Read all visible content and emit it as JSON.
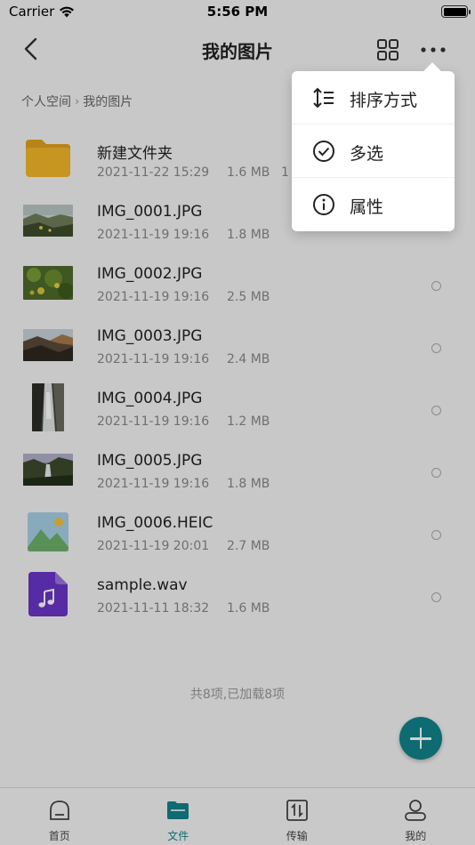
{
  "status_bar": {
    "carrier": "Carrier",
    "time": "5:56 PM"
  },
  "nav": {
    "title": "我的图片"
  },
  "breadcrumb": {
    "root": "个人空间",
    "current": "我的图片"
  },
  "files": [
    {
      "name": "新建文件夹",
      "date": "2021-11-22 15:29",
      "size": "1.6 MB",
      "extra": "1",
      "type": "folder"
    },
    {
      "name": "IMG_0001.JPG",
      "date": "2021-11-19 19:16",
      "size": "1.8 MB",
      "type": "photo"
    },
    {
      "name": "IMG_0002.JPG",
      "date": "2021-11-19 19:16",
      "size": "2.5 MB",
      "type": "photo"
    },
    {
      "name": "IMG_0003.JPG",
      "date": "2021-11-19 19:16",
      "size": "2.4 MB",
      "type": "photo"
    },
    {
      "name": "IMG_0004.JPG",
      "date": "2021-11-19 19:16",
      "size": "1.2 MB",
      "type": "photo"
    },
    {
      "name": "IMG_0005.JPG",
      "date": "2021-11-19 19:16",
      "size": "1.8 MB",
      "type": "photo"
    },
    {
      "name": "IMG_0006.HEIC",
      "date": "2021-11-19 20:01",
      "size": "2.7 MB",
      "type": "image-placeholder"
    },
    {
      "name": "sample.wav",
      "date": "2021-11-11 18:32",
      "size": "1.6 MB",
      "type": "audio"
    }
  ],
  "footer_note": "共8项,已加载8项",
  "tabs": [
    {
      "label": "首页",
      "icon": "home-icon"
    },
    {
      "label": "文件",
      "icon": "folder-icon",
      "active": true
    },
    {
      "label": "传输",
      "icon": "transfer-icon"
    },
    {
      "label": "我的",
      "icon": "user-icon"
    }
  ],
  "menu": {
    "items": [
      {
        "label": "排序方式",
        "icon": "sort-icon"
      },
      {
        "label": "多选",
        "icon": "check-circle-icon"
      },
      {
        "label": "属性",
        "icon": "info-icon"
      }
    ]
  },
  "colors": {
    "accent": "#11838a",
    "folder": "#f2b728",
    "audio": "#6a35c8",
    "placeholder_sky": "#a8d0e6",
    "placeholder_hill": "#6db06a",
    "placeholder_sun": "#f2c33a"
  }
}
